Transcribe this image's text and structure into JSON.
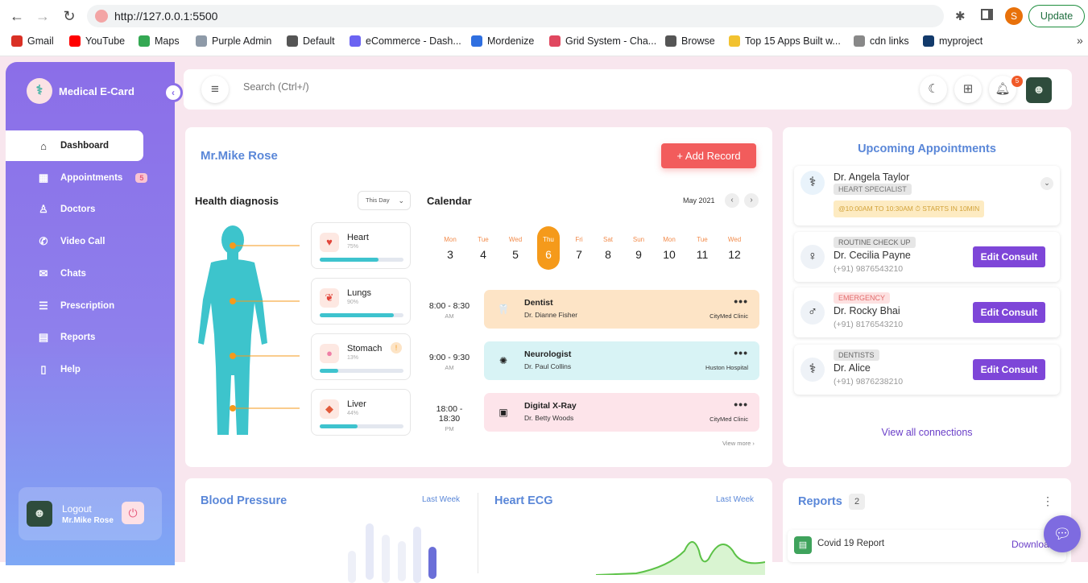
{
  "browser": {
    "url": "http://127.0.0.1:5500",
    "profile_initial": "S",
    "update_label": "Update",
    "bookmarks": [
      {
        "label": "Gmail",
        "color": "#d93025"
      },
      {
        "label": "YouTube",
        "color": "#ff0000"
      },
      {
        "label": "Maps",
        "color": "#34a853"
      },
      {
        "label": "Purple Admin",
        "color": "#8e9aa8"
      },
      {
        "label": "Default",
        "color": "#555555"
      },
      {
        "label": "eCommerce - Dash...",
        "color": "#6b63f2"
      },
      {
        "label": "Mordenize",
        "color": "#2f6fe0"
      },
      {
        "label": "Grid System - Cha...",
        "color": "#e0475f"
      },
      {
        "label": "Browse",
        "color": "#555555"
      },
      {
        "label": "Top 15 Apps Built w...",
        "color": "#f2c230"
      },
      {
        "label": "cdn links",
        "color": "#888888"
      },
      {
        "label": "myproject",
        "color": "#123a6b"
      }
    ],
    "more": "»"
  },
  "sidebar": {
    "brand": "Medical E-Card",
    "items": [
      {
        "label": "Dashboard",
        "icon": "home-icon",
        "glyph": "⌂",
        "active": true
      },
      {
        "label": "Appointments",
        "icon": "calendar-icon",
        "glyph": "▦",
        "badge": "5"
      },
      {
        "label": "Doctors",
        "icon": "user-icon",
        "glyph": "♙"
      },
      {
        "label": "Video Call",
        "icon": "phone-icon",
        "glyph": "✆"
      },
      {
        "label": "Chats",
        "icon": "chat-icon",
        "glyph": "✉"
      },
      {
        "label": "Prescription",
        "icon": "prescription-icon",
        "glyph": "☰"
      },
      {
        "label": "Reports",
        "icon": "table-icon",
        "glyph": "▤"
      },
      {
        "label": "Help",
        "icon": "document-icon",
        "glyph": "▯"
      }
    ],
    "logout": {
      "label": "Logout",
      "user": "Mr.Mike Rose"
    }
  },
  "topbar": {
    "search_placeholder": "Search (Ctrl+/)",
    "notification_count": "5"
  },
  "patient": {
    "name": "Mr.Mike Rose",
    "add_record": "+ Add Record"
  },
  "diagnosis": {
    "title": "Health diagnosis",
    "filter": "This Day",
    "organs": [
      {
        "name": "Heart",
        "percent": "75%",
        "value": 0.7,
        "bg": "#fde8e2",
        "glyph": "♥",
        "color": "#e2463b"
      },
      {
        "name": "Lungs",
        "percent": "90%",
        "value": 0.88,
        "bg": "#fde8e2",
        "glyph": "❦",
        "color": "#e2463b"
      },
      {
        "name": "Stomach",
        "percent": "13%",
        "value": 0.22,
        "bg": "#fde8e2",
        "glyph": "●",
        "color": "#f07fa7",
        "alert": "!"
      },
      {
        "name": "Liver",
        "percent": "44%",
        "value": 0.45,
        "bg": "#fde8e2",
        "glyph": "◆",
        "color": "#e25a3b"
      }
    ]
  },
  "calendar": {
    "title": "Calendar",
    "month": "May 2021",
    "days": [
      {
        "dn": "Mon",
        "dd": "3"
      },
      {
        "dn": "Tue",
        "dd": "4"
      },
      {
        "dn": "Wed",
        "dd": "5"
      },
      {
        "dn": "Thu",
        "dd": "6",
        "selected": true
      },
      {
        "dn": "Fri",
        "dd": "7"
      },
      {
        "dn": "Sat",
        "dd": "8"
      },
      {
        "dn": "Sun",
        "dd": "9"
      },
      {
        "dn": "Mon",
        "dd": "10"
      },
      {
        "dn": "Tue",
        "dd": "11"
      },
      {
        "dn": "Wed",
        "dd": "12"
      }
    ],
    "slots": [
      {
        "time": "8:00 - 8:30",
        "ampm": "AM",
        "title": "Dentist",
        "doctor": "Dr. Dianne Fisher",
        "clinic": "CityMed Clinic",
        "bg": "#fde4c6",
        "glyph": "🦷"
      },
      {
        "time": "9:00 - 9:30",
        "ampm": "AM",
        "title": "Neurologist",
        "doctor": "Dr. Paul Collins",
        "clinic": "Huston Hospital",
        "bg": "#d8f3f5",
        "glyph": "✺"
      },
      {
        "time": "18:00 - 18:30",
        "ampm": "PM",
        "title": "Digital X-Ray",
        "doctor": "Dr. Betty Woods",
        "clinic": "CityMed Clinic",
        "bg": "#fde4ea",
        "glyph": "▣"
      }
    ],
    "more_dots": "•••",
    "view_more": "View more ›"
  },
  "appointments": {
    "title": "Upcoming Appointments",
    "first": {
      "name": "Dr. Angela Taylor",
      "tag": "HEART SPECIALIST",
      "time": "@10:00AM TO 10:30AM ⏱ STARTS IN 10MIN"
    },
    "list": [
      {
        "tag": "ROUTINE CHECK UP",
        "tag_bg": "#e6e6e6",
        "tag_color": "#666666",
        "name": "Dr. Cecilia Payne",
        "phone": "(+91) 9876543210",
        "button": "Edit Consult"
      },
      {
        "tag": "EMERGENCY",
        "tag_bg": "#fde1e1",
        "tag_color": "#e26a6a",
        "name": "Dr. Rocky Bhai",
        "phone": "(+91) 8176543210",
        "button": "Edit Consult"
      },
      {
        "tag": "DENTISTS",
        "tag_bg": "#e6e6e6",
        "tag_color": "#666666",
        "name": "Dr. Alice",
        "phone": "(+91) 9876238210",
        "button": "Edit Consult"
      }
    ],
    "view_all": "View all connections"
  },
  "bp": {
    "title": "Blood Pressure",
    "range": "Last Week"
  },
  "ecg": {
    "title": "Heart ECG",
    "range": "Last Week"
  },
  "reports": {
    "title": "Reports",
    "count": "2",
    "item": "Covid 19 Report",
    "action": "Download"
  }
}
